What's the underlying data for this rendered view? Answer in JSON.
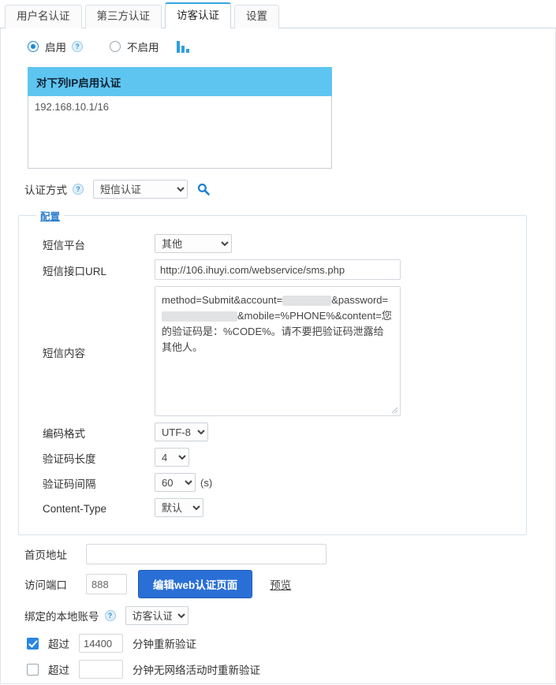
{
  "tabs": [
    {
      "label": "用户名认证",
      "active": false
    },
    {
      "label": "第三方认证",
      "active": false
    },
    {
      "label": "访客认证",
      "active": true
    },
    {
      "label": "设置",
      "active": false
    }
  ],
  "enable_section": {
    "enabled_label": "启用",
    "disabled_label": "不启用",
    "enabled_selected": true,
    "help_glyph": "?",
    "chart_icon": "bar-chart-icon"
  },
  "ip_box": {
    "header": "对下列IP启用认证",
    "value": "192.168.10.1/16"
  },
  "auth_mode": {
    "label": "认证方式",
    "help_glyph": "?",
    "selected": "短信认证",
    "options": [
      "短信认证"
    ],
    "search_icon": "search-icon"
  },
  "config": {
    "legend": "配置",
    "platform": {
      "label": "短信平台",
      "selected": "其他",
      "options": [
        "其他"
      ]
    },
    "url": {
      "label": "短信接口URL",
      "value": "http://106.ihuyi.com/webservice/sms.php"
    },
    "content": {
      "label": "短信内容",
      "part1": "method=Submit&account=",
      "part2": "&password=",
      "part3": "&mobile=%PHONE%&content=您的验证码是：%CODE%。请不要把验证码泄露给其他人。",
      "redacted_account": "",
      "redacted_password": ""
    },
    "encoding": {
      "label": "编码格式",
      "selected": "UTF-8",
      "options": [
        "UTF-8"
      ]
    },
    "code_length": {
      "label": "验证码长度",
      "selected": "4",
      "options": [
        "4"
      ]
    },
    "code_interval": {
      "label": "验证码间隔",
      "selected": "60",
      "options": [
        "60"
      ],
      "unit": "(s)"
    },
    "content_type": {
      "label": "Content-Type",
      "selected": "默认",
      "options": [
        "默认"
      ]
    }
  },
  "bottom": {
    "home_url": {
      "label": "首页地址",
      "value": ""
    },
    "port": {
      "label": "访问端口",
      "value": "888"
    },
    "edit_button": "编辑web认证页面",
    "preview_link": "预览",
    "bind_account": {
      "label": "绑定的本地账号",
      "help_glyph": "?",
      "selected": "访客认证",
      "options": [
        "访客认证"
      ]
    },
    "reauth_time": {
      "checked": true,
      "prefix": "超过",
      "value": "14400",
      "suffix": "分钟重新验证"
    },
    "reauth_idle": {
      "checked": false,
      "prefix": "超过",
      "value": "",
      "suffix": "分钟无网络活动时重新验证"
    }
  },
  "colors": {
    "accent": "#2a6fd6",
    "tab_active_top": "#36a5e0",
    "ip_header_bg": "#5ec5f0",
    "legend": "#2f7fd0"
  }
}
